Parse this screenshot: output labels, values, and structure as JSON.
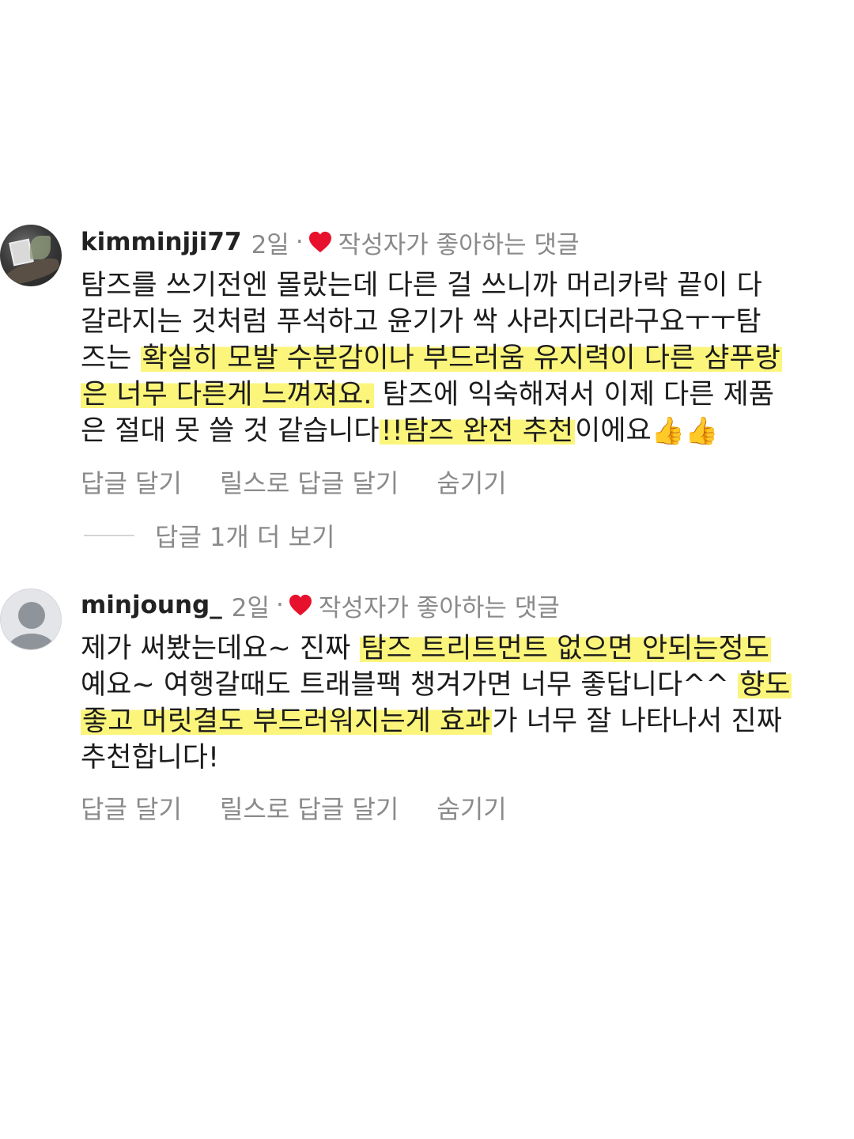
{
  "comments": [
    {
      "username": "kimminjji77",
      "time": "2일",
      "separator": "·",
      "liked_label": "작성자가 좋아하는 댓글",
      "lines": [
        {
          "parts": [
            {
              "text": "탐즈를 쓰기전엔 몰랐는데 다른 걸 쓰니까 머리카락 끝이 다",
              "hl": false
            }
          ]
        },
        {
          "parts": [
            {
              "text": "갈라지는 것처럼 푸석하고 윤기가 싹 사라지더라구요ㅜㅜ탐",
              "hl": false
            }
          ]
        },
        {
          "parts": [
            {
              "text": "즈는 ",
              "hl": false
            },
            {
              "text": "확실히 모발 수분감이나 부드러움 유지력이 다른 샴푸랑",
              "hl": true
            }
          ]
        },
        {
          "parts": [
            {
              "text": "은 너무 다른게 느껴져요.",
              "hl": true
            },
            {
              "text": " 탐즈에 익숙해져서 이제 다른 제품",
              "hl": false
            }
          ]
        },
        {
          "parts": [
            {
              "text": "은 절대 못 쓸 것 같습니다",
              "hl": false
            },
            {
              "text": "!!탐즈 완전 추천",
              "hl": true
            },
            {
              "text": "이에요",
              "hl": false
            }
          ]
        }
      ],
      "emoji": "👍👍",
      "actions": [
        "답글 달기",
        "릴스로 답글 달기",
        "숨기기"
      ],
      "view_replies": "답글 1개 더 보기"
    },
    {
      "username": "minjoung_",
      "time": "2일",
      "separator": "·",
      "liked_label": "작성자가 좋아하는 댓글",
      "lines": [
        {
          "parts": [
            {
              "text": "제가 써봤는데요~ 진짜 ",
              "hl": false
            },
            {
              "text": "탐즈 트리트먼트 없으면 안되는정도",
              "hl": true
            }
          ]
        },
        {
          "parts": [
            {
              "text": "예요~ 여행갈때도 트래블팩 챙겨가면 너무 좋답니다^^ ",
              "hl": false
            },
            {
              "text": "향도",
              "hl": true
            }
          ]
        },
        {
          "parts": [
            {
              "text": "좋고 머릿결도 부드러워지는게 효과",
              "hl": true
            },
            {
              "text": "가 너무 잘 나타나서 진짜",
              "hl": false
            }
          ]
        },
        {
          "parts": [
            {
              "text": "추천합니다!",
              "hl": false
            }
          ]
        }
      ],
      "actions": [
        "답글 달기",
        "릴스로 답글 달기",
        "숨기기"
      ]
    }
  ],
  "colors": {
    "heart": "#e8112d",
    "highlight": "#fbf57c",
    "muted_text": "#8a8a8a"
  },
  "icons": {
    "heart": "heart-icon",
    "thumbs_up": "thumbs-up-emoji"
  }
}
